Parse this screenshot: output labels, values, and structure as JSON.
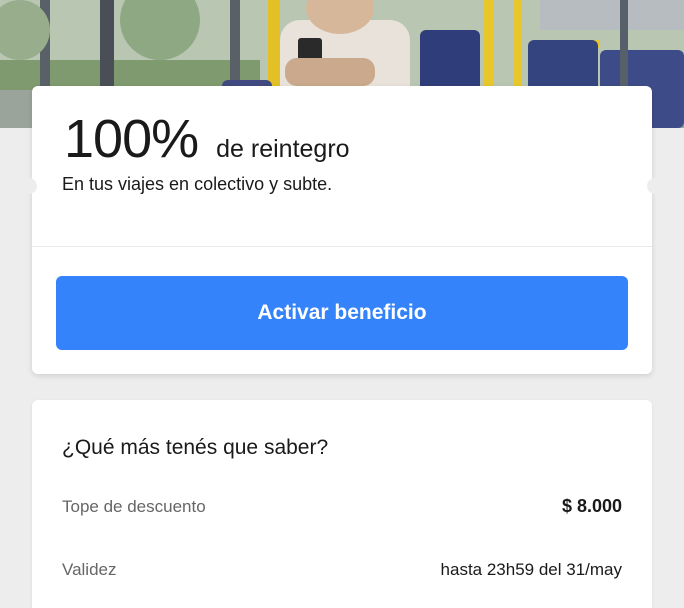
{
  "hero": {
    "image": "bus-interior-photo"
  },
  "benefit": {
    "percent": "100%",
    "suffix": "de reintegro",
    "description": "En tus viajes en colectivo y subte.",
    "button_label": "Activar beneficio",
    "button_color": "#3483fa"
  },
  "info": {
    "title": "¿Qué más tenés que saber?",
    "rows": [
      {
        "label": "Tope de descuento",
        "value": "$ 8.000"
      },
      {
        "label": "Validez",
        "value": "hasta 23h59 del 31/may"
      }
    ]
  }
}
